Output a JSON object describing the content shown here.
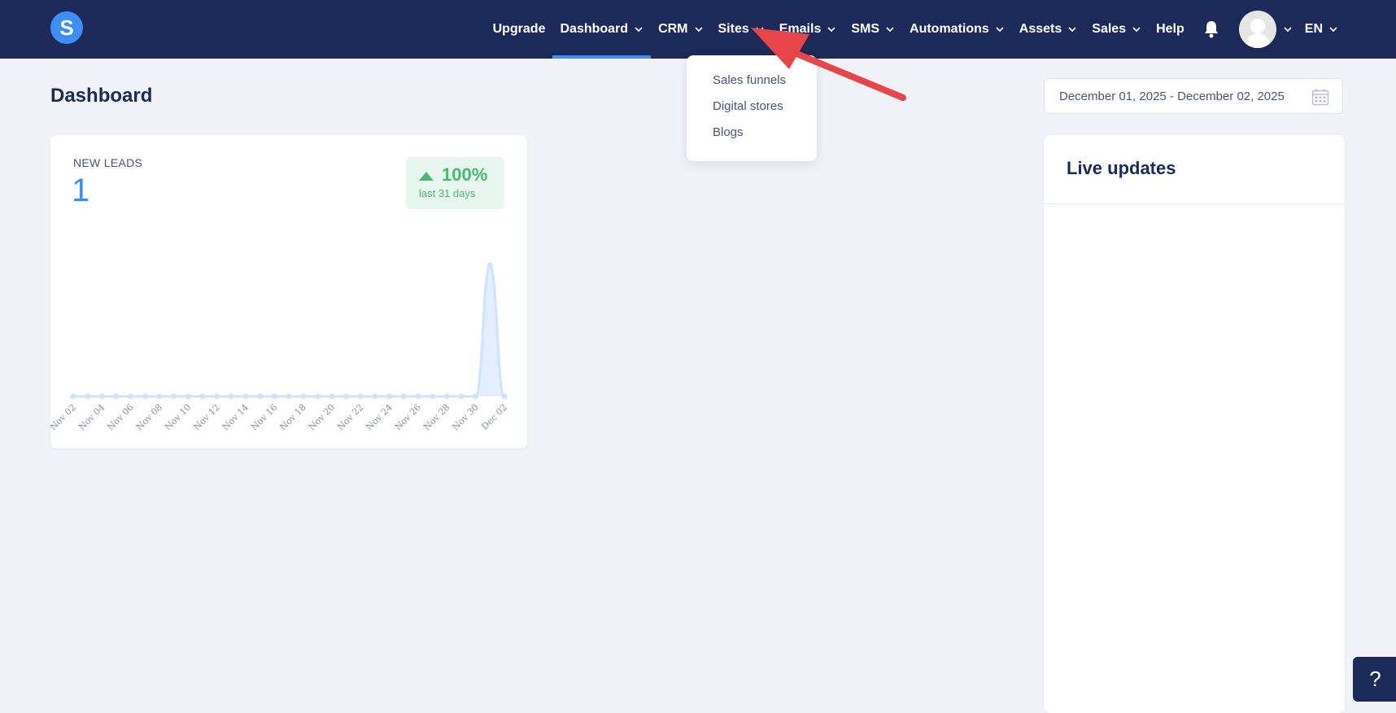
{
  "app": {
    "logo_letter": "S"
  },
  "nav": {
    "upgrade": "Upgrade",
    "dashboard": "Dashboard",
    "crm": "CRM",
    "sites": "Sites",
    "emails": "Emails",
    "sms": "SMS",
    "automations": "Automations",
    "assets": "Assets",
    "sales": "Sales",
    "help": "Help",
    "language": "EN"
  },
  "sites_menu": {
    "items": [
      "Sales funnels",
      "Digital stores",
      "Blogs"
    ]
  },
  "page": {
    "title": "Dashboard"
  },
  "date_range": {
    "value": "December 01, 2025 - December 02, 2025"
  },
  "leads_card": {
    "label": "NEW LEADS",
    "value": "1",
    "change": "100%",
    "period": "last 31 days"
  },
  "live_updates": {
    "title": "Live updates"
  },
  "help_button": {
    "label": "?"
  },
  "colors": {
    "nav_bg": "#1c2a5a",
    "accent": "#3e8ef7",
    "positive": "#49b96f",
    "annotation_arrow": "#e8454a"
  },
  "chart_data": {
    "type": "area",
    "x": [
      "Nov 02",
      "Nov 03",
      "Nov 04",
      "Nov 05",
      "Nov 06",
      "Nov 07",
      "Nov 08",
      "Nov 09",
      "Nov 10",
      "Nov 11",
      "Nov 12",
      "Nov 13",
      "Nov 14",
      "Nov 15",
      "Nov 16",
      "Nov 17",
      "Nov 18",
      "Nov 19",
      "Nov 20",
      "Nov 21",
      "Nov 22",
      "Nov 23",
      "Nov 24",
      "Nov 25",
      "Nov 26",
      "Nov 27",
      "Nov 28",
      "Nov 29",
      "Nov 30",
      "Dec 01",
      "Dec 02"
    ],
    "tick_labels": [
      "Nov 02",
      "Nov 04",
      "Nov 06",
      "Nov 08",
      "Nov 10",
      "Nov 12",
      "Nov 14",
      "Nov 16",
      "Nov 18",
      "Nov 20",
      "Nov 22",
      "Nov 24",
      "Nov 26",
      "Nov 28",
      "Nov 30",
      "Dec 02"
    ],
    "series": [
      {
        "values": [
          0,
          0,
          0,
          0,
          0,
          0,
          0,
          0,
          0,
          0,
          0,
          0,
          0,
          0,
          0,
          0,
          0,
          0,
          0,
          0,
          0,
          0,
          0,
          0,
          0,
          0,
          0,
          0,
          0,
          1,
          0
        ]
      }
    ],
    "ylim": [
      0,
      1
    ],
    "grid": false
  }
}
